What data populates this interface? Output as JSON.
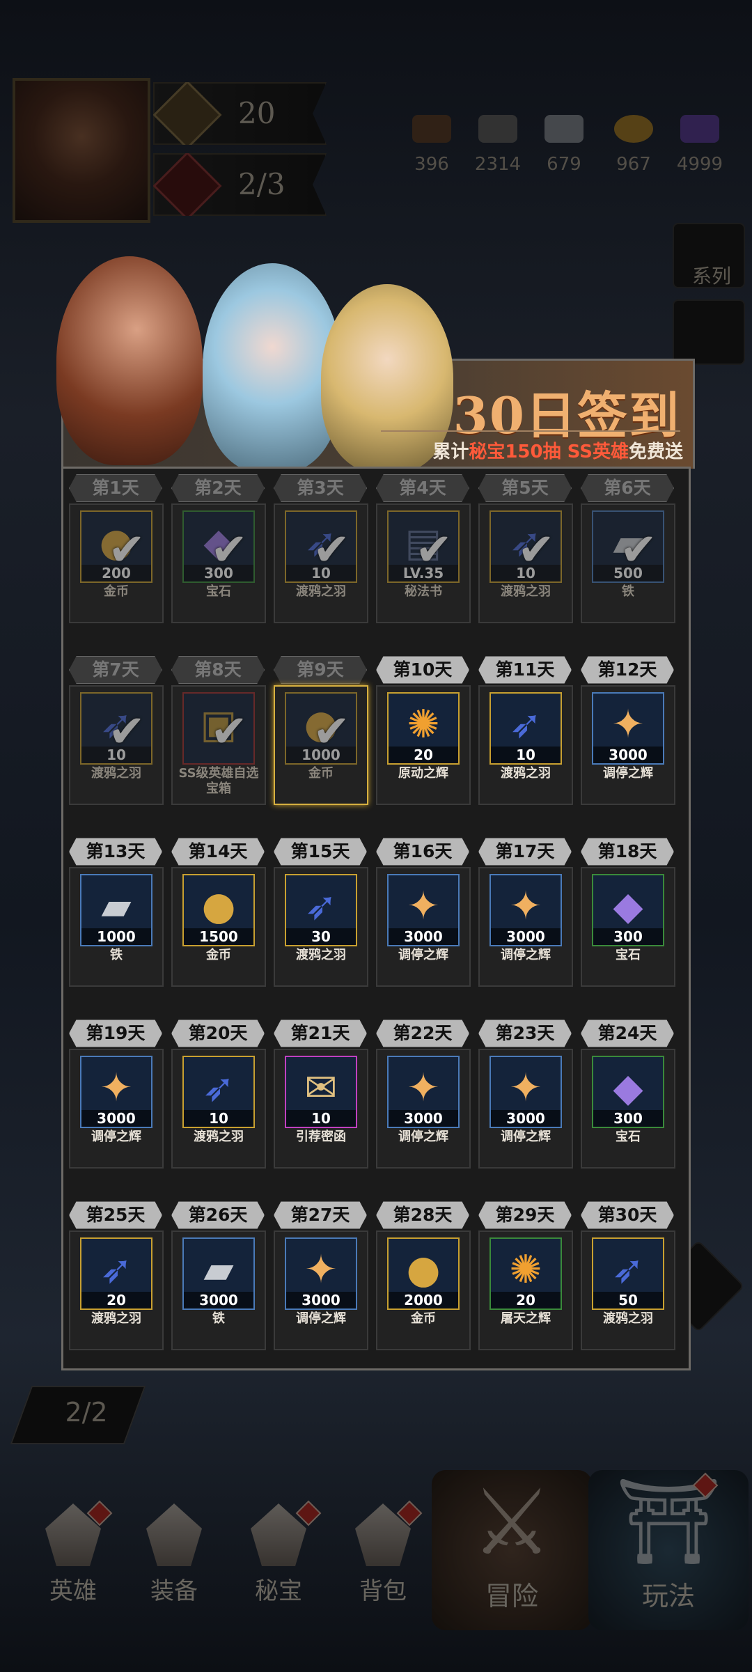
{
  "hud": {
    "stat1": "20",
    "stat2": "2/3",
    "resources": [
      "396",
      "2314",
      "679",
      "967",
      "4999"
    ],
    "side_label": "系列",
    "count_pill": "2/2"
  },
  "banner": {
    "title": "30日签到",
    "sub_pre": "累计",
    "sub_hl1": "秘宝150抽",
    "sub_mid": " ",
    "sub_hl2": "SS英雄",
    "sub_post": "免费送"
  },
  "days": [
    {
      "label": "第1天",
      "amount": "200",
      "name": "金币",
      "claimed": true,
      "frame": "gold",
      "icon": "coin-icon"
    },
    {
      "label": "第2天",
      "amount": "300",
      "name": "宝石",
      "claimed": true,
      "frame": "green",
      "icon": "gem-icon"
    },
    {
      "label": "第3天",
      "amount": "10",
      "name": "渡鸦之羽",
      "claimed": true,
      "frame": "gold",
      "icon": "feather-icon"
    },
    {
      "label": "第4天",
      "amount": "LV.35",
      "name": "秘法书",
      "claimed": true,
      "frame": "gold",
      "icon": "book-icon"
    },
    {
      "label": "第5天",
      "amount": "10",
      "name": "渡鸦之羽",
      "claimed": true,
      "frame": "gold",
      "icon": "feather-icon"
    },
    {
      "label": "第6天",
      "amount": "500",
      "name": "铁",
      "claimed": true,
      "frame": "blue",
      "icon": "iron-icon"
    },
    {
      "label": "第7天",
      "amount": "10",
      "name": "渡鸦之羽",
      "claimed": true,
      "frame": "gold",
      "icon": "feather-icon"
    },
    {
      "label": "第8天",
      "amount": "",
      "name": "SS级英雄自选宝箱",
      "claimed": true,
      "frame": "red",
      "icon": "chest-icon"
    },
    {
      "label": "第9天",
      "amount": "1000",
      "name": "金币",
      "claimed": true,
      "current": true,
      "frame": "gold",
      "icon": "coin-icon"
    },
    {
      "label": "第10天",
      "amount": "20",
      "name": "原动之辉",
      "claimed": false,
      "frame": "gold",
      "icon": "radiance-icon"
    },
    {
      "label": "第11天",
      "amount": "10",
      "name": "渡鸦之羽",
      "claimed": false,
      "frame": "gold",
      "icon": "feather-icon"
    },
    {
      "label": "第12天",
      "amount": "3000",
      "name": "调停之辉",
      "claimed": false,
      "frame": "blue",
      "icon": "star-icon"
    },
    {
      "label": "第13天",
      "amount": "1000",
      "name": "铁",
      "claimed": false,
      "frame": "blue",
      "icon": "iron-icon"
    },
    {
      "label": "第14天",
      "amount": "1500",
      "name": "金币",
      "claimed": false,
      "frame": "gold",
      "icon": "coin-icon"
    },
    {
      "label": "第15天",
      "amount": "30",
      "name": "渡鸦之羽",
      "claimed": false,
      "frame": "gold",
      "icon": "feather-icon"
    },
    {
      "label": "第16天",
      "amount": "3000",
      "name": "调停之辉",
      "claimed": false,
      "frame": "blue",
      "icon": "star-icon"
    },
    {
      "label": "第17天",
      "amount": "3000",
      "name": "调停之辉",
      "claimed": false,
      "frame": "blue",
      "icon": "star-icon"
    },
    {
      "label": "第18天",
      "amount": "300",
      "name": "宝石",
      "claimed": false,
      "frame": "green",
      "icon": "gem-icon"
    },
    {
      "label": "第19天",
      "amount": "3000",
      "name": "调停之辉",
      "claimed": false,
      "frame": "blue",
      "icon": "star-icon"
    },
    {
      "label": "第20天",
      "amount": "10",
      "name": "渡鸦之羽",
      "claimed": false,
      "frame": "gold",
      "icon": "feather-icon"
    },
    {
      "label": "第21天",
      "amount": "10",
      "name": "引荐密函",
      "claimed": false,
      "frame": "purple",
      "icon": "scroll-icon"
    },
    {
      "label": "第22天",
      "amount": "3000",
      "name": "调停之辉",
      "claimed": false,
      "frame": "blue",
      "icon": "star-icon"
    },
    {
      "label": "第23天",
      "amount": "3000",
      "name": "调停之辉",
      "claimed": false,
      "frame": "blue",
      "icon": "star-icon"
    },
    {
      "label": "第24天",
      "amount": "300",
      "name": "宝石",
      "claimed": false,
      "frame": "green",
      "icon": "gem-icon"
    },
    {
      "label": "第25天",
      "amount": "20",
      "name": "渡鸦之羽",
      "claimed": false,
      "frame": "gold",
      "icon": "feather-icon"
    },
    {
      "label": "第26天",
      "amount": "3000",
      "name": "铁",
      "claimed": false,
      "frame": "blue",
      "icon": "iron-icon"
    },
    {
      "label": "第27天",
      "amount": "3000",
      "name": "调停之辉",
      "claimed": false,
      "frame": "blue",
      "icon": "star-icon"
    },
    {
      "label": "第28天",
      "amount": "2000",
      "name": "金币",
      "claimed": false,
      "frame": "gold",
      "icon": "coin-icon"
    },
    {
      "label": "第29天",
      "amount": "20",
      "name": "屠天之辉",
      "claimed": false,
      "frame": "green",
      "icon": "radiance-icon"
    },
    {
      "label": "第30天",
      "amount": "50",
      "name": "渡鸦之羽",
      "claimed": false,
      "frame": "gold",
      "icon": "feather-icon"
    }
  ],
  "nav": {
    "hero": "英雄",
    "equip": "装备",
    "treasure": "秘宝",
    "bag": "背包",
    "adventure": "冒险",
    "play": "玩法"
  }
}
